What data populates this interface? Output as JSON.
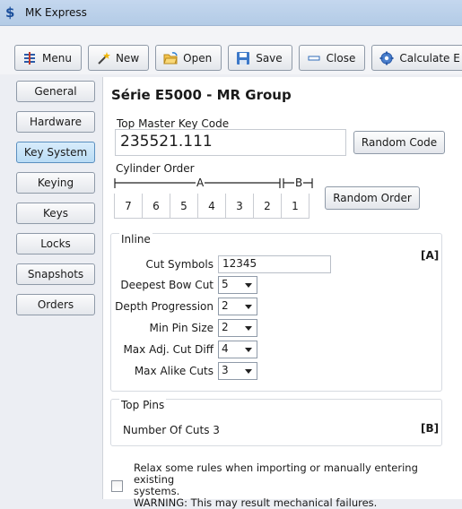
{
  "window": {
    "title": "MK Express"
  },
  "toolbar": {
    "menu": "Menu",
    "new": "New",
    "open": "Open",
    "save": "Save",
    "close": "Close",
    "calculate": "Calculate E"
  },
  "sidebar": {
    "items": [
      "General",
      "Hardware",
      "Key System",
      "Keying",
      "Keys",
      "Locks",
      "Snapshots",
      "Orders"
    ],
    "active": "Key System"
  },
  "main": {
    "title": "Série E5000 - MR Group",
    "top_master_label": "Top Master Key Code",
    "top_master_value": "235521.111",
    "random_code": "Random Code",
    "cylinder_order_label": "Cylinder Order",
    "order_groups": [
      "A",
      "B"
    ],
    "order_digits": [
      "7",
      "6",
      "5",
      "4",
      "3",
      "2",
      "1"
    ],
    "random_order": "Random Order"
  },
  "inline": {
    "title": "Inline",
    "tag": "[A]",
    "cut_symbols_label": "Cut Symbols",
    "cut_symbols_value": "12345",
    "deepest_bow_cut_label": "Deepest Bow Cut",
    "deepest_bow_cut_value": "5",
    "depth_progression_label": "Depth Progression",
    "depth_progression_value": "2",
    "min_pin_size_label": "Min Pin Size",
    "min_pin_size_value": "2",
    "max_adj_cut_diff_label": "Max Adj. Cut Diff",
    "max_adj_cut_diff_value": "4",
    "max_alike_cuts_label": "Max Alike Cuts",
    "max_alike_cuts_value": "3"
  },
  "top_pins": {
    "title": "Top Pins",
    "tag": "[B]",
    "number_of_cuts_label": "Number Of Cuts",
    "number_of_cuts_value": "3"
  },
  "relax": {
    "line1": "Relax some rules when importing or manually entering existing",
    "line2": "systems.",
    "line3": "WARNING: This may result mechanical failures."
  }
}
